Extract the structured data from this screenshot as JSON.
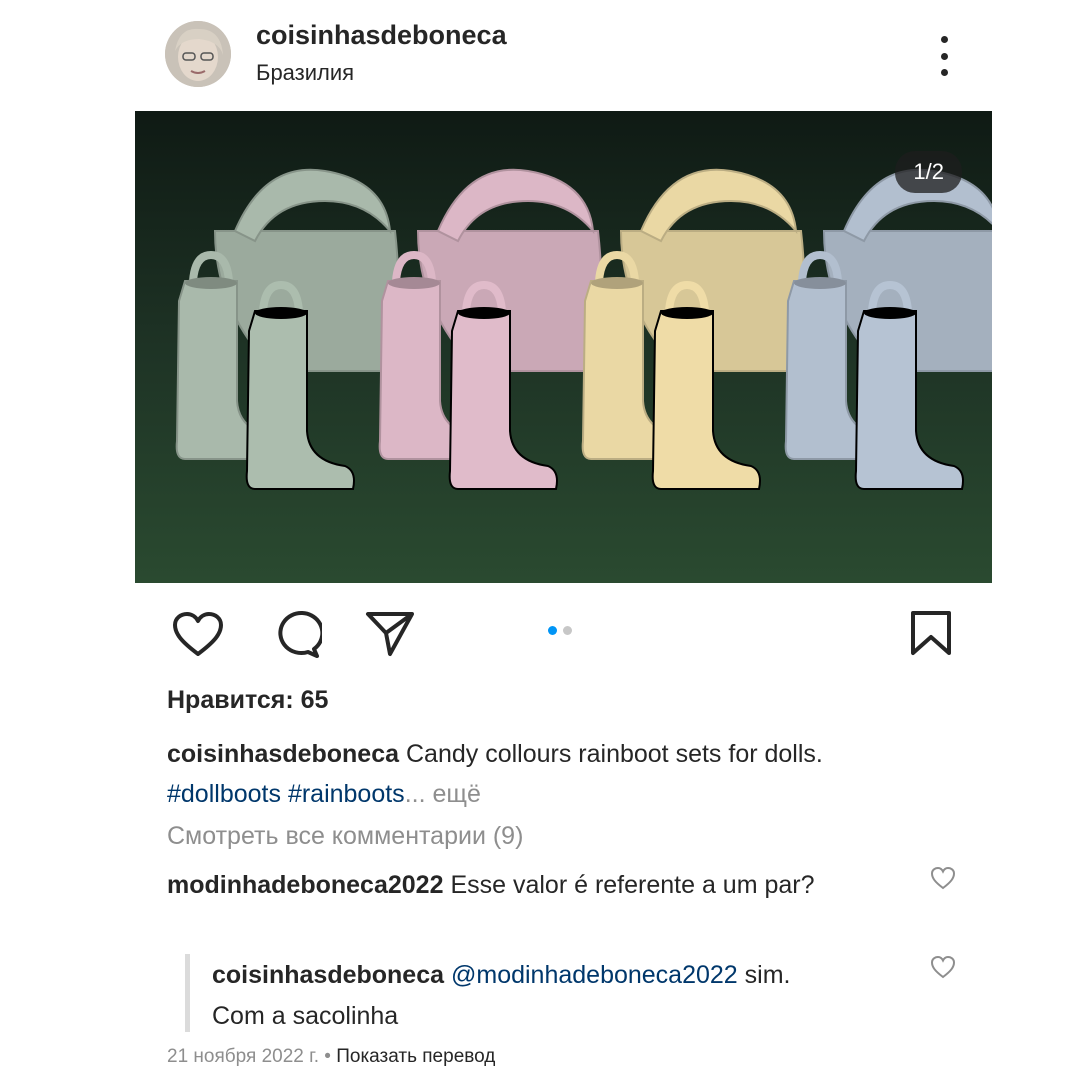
{
  "header": {
    "username": "coisinhasdeboneca",
    "location": "Бразилия"
  },
  "photo": {
    "counter": "1/2",
    "boot_colors": [
      "#a9b9ab",
      "#dcb7c6",
      "#ead8a4",
      "#b2bfcf"
    ]
  },
  "carousel": {
    "active_color": "#0095f6",
    "inactive_color": "#c7c7c7"
  },
  "likes": "Нравится: 65",
  "caption": {
    "username": "coisinhasdeboneca",
    "text": "Candy collours rainboot sets for dolls.",
    "hashtag_1": "#dollboots",
    "hashtag_2": "#rainboots",
    "ellipsis": "...",
    "more": " ещё"
  },
  "view_all_comments": "Смотреть все комментарии (9)",
  "comment": {
    "username": "modinhadeboneca2022",
    "text": "Esse valor é referente a um par?"
  },
  "reply": {
    "username": "coisinhasdeboneca",
    "mention": "@modinhadeboneca2022",
    "text_1": "sim.",
    "text_2": "Com a sacolinha"
  },
  "footer": {
    "date": "21 ноября 2022 г.",
    "separator": " • ",
    "translate": "Показать перевод"
  }
}
